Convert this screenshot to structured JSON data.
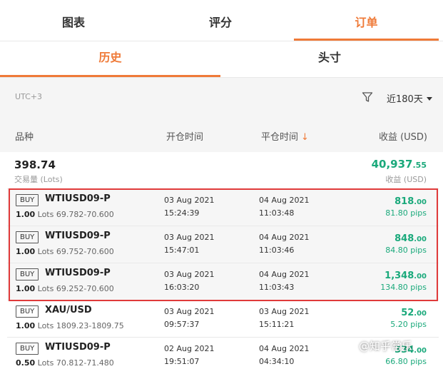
{
  "top_tabs": [
    {
      "label": "图表"
    },
    {
      "label": "评分"
    },
    {
      "label": "订单"
    }
  ],
  "sub_tabs": [
    {
      "label": "历史"
    },
    {
      "label": "头寸"
    }
  ],
  "filter": {
    "timezone": "UTC+3",
    "period": "近180天"
  },
  "columns": {
    "instrument": "品种",
    "open_time": "开仓时间",
    "close_time": "平仓时间",
    "sort_arrow": "↓",
    "profit": "收益 (USD)"
  },
  "summary": {
    "lots": "398.74",
    "lots_label": "交易量 (Lots)",
    "profit_main": "40,937",
    "profit_cents": ".55",
    "profit_label": "收益 (USD)"
  },
  "orders": [
    {
      "side": "BUY",
      "symbol": "WTIUSD09-P",
      "lots": "1.00",
      "lots_unit": "Lots",
      "price_range": "69.782-70.600",
      "open_date": "03 Aug 2021",
      "open_time": "15:24:39",
      "close_date": "04 Aug 2021",
      "close_time": "11:03:48",
      "profit_main": "818",
      "profit_cents": ".00",
      "pips": "81.80 pips"
    },
    {
      "side": "BUY",
      "symbol": "WTIUSD09-P",
      "lots": "1.00",
      "lots_unit": "Lots",
      "price_range": "69.752-70.600",
      "open_date": "03 Aug 2021",
      "open_time": "15:47:01",
      "close_date": "04 Aug 2021",
      "close_time": "11:03:46",
      "profit_main": "848",
      "profit_cents": ".00",
      "pips": "84.80 pips"
    },
    {
      "side": "BUY",
      "symbol": "WTIUSD09-P",
      "lots": "1.00",
      "lots_unit": "Lots",
      "price_range": "69.252-70.600",
      "open_date": "03 Aug 2021",
      "open_time": "16:03:20",
      "close_date": "04 Aug 2021",
      "close_time": "11:03:43",
      "profit_main": "1,348",
      "profit_cents": ".00",
      "pips": "134.80 pips"
    },
    {
      "side": "BUY",
      "symbol": "XAU/USD",
      "lots": "1.00",
      "lots_unit": "Lots",
      "price_range": "1809.23-1809.75",
      "open_date": "03 Aug 2021",
      "open_time": "09:57:37",
      "close_date": "03 Aug 2021",
      "close_time": "15:11:21",
      "profit_main": "52",
      "profit_cents": ".00",
      "pips": "5.20 pips"
    },
    {
      "side": "BUY",
      "symbol": "WTIUSD09-P",
      "lots": "0.50",
      "lots_unit": "Lots",
      "price_range": "70.812-71.480",
      "open_date": "02 Aug 2021",
      "open_time": "19:51:07",
      "close_date": "04 Aug 2021",
      "close_time": "04:34:10",
      "profit_main": "334",
      "profit_cents": ".00",
      "pips": "66.80 pips"
    }
  ],
  "watermark": "@知乎常乐",
  "colors": {
    "accent": "#ef7a38",
    "profit_green": "#1aa97b",
    "highlight_red": "#e03a3a"
  }
}
